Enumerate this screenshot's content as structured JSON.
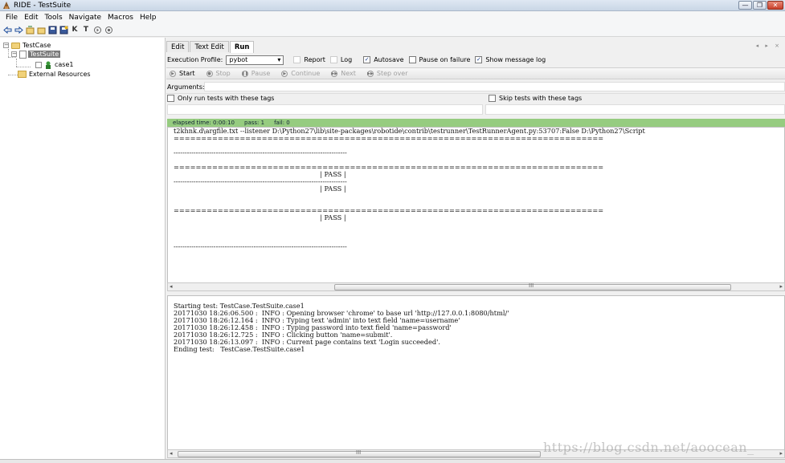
{
  "window": {
    "title": "RIDE - TestSuite",
    "controls": [
      "minimize",
      "restore",
      "close"
    ]
  },
  "menu": [
    "File",
    "Edit",
    "Tools",
    "Navigate",
    "Macros",
    "Help"
  ],
  "toolbar": {
    "icons": [
      "back-arrow-icon",
      "forward-arrow-icon",
      "open-suite-icon",
      "open-directory-icon",
      "save-icon",
      "save-all-icon",
      "search-keyword-icon",
      "search-test-icon",
      "step-icon",
      "record-icon"
    ],
    "k_glyph": "K",
    "t_glyph": "T"
  },
  "tree": {
    "root": "TestCase",
    "suite": "TestSuite",
    "case": "case1",
    "resources": "External Resources"
  },
  "tabs": [
    "Edit",
    "Text Edit",
    "Run"
  ],
  "tab_arrows": "◂ ▸ ×",
  "execution": {
    "profile_label": "Execution Profile:",
    "profile_value": "pybot",
    "report": "Report",
    "log": "Log",
    "autosave": "Autosave",
    "autosave_checked": true,
    "pause_on_failure": "Pause on failure",
    "pause_checked": false,
    "show_message_log": "Show message log",
    "show_checked": true
  },
  "run_controls": {
    "start": "Start",
    "stop": "Stop",
    "pause": "Pause",
    "continue": "Continue",
    "next": "Next",
    "step_over": "Step over"
  },
  "arguments_label": "Arguments:",
  "tags": {
    "only_run": "Only run tests with these tags",
    "skip": "Skip tests with these tags"
  },
  "status": {
    "elapsed": "elapsed time: 0:00:10",
    "pass": "pass: 1",
    "fail": "fail: 0"
  },
  "output_text": "t2khnk.d\\argfile.txt --listener D:\\Python27\\lib\\site-packages\\robotide\\contrib\\testrunner\\TestRunnerAgent.py:53707:False D:\\Python27\\Script\n==============================================================================\n\n------------------------------------------------------------------------------\n\n==============================================================================\n                                                                      | PASS |\n------------------------------------------------------------------------------\n                                                                      | PASS |\n\n\n==============================================================================\n                                                                      | PASS |\n\n\n\n------------------------------------------------------------------------------",
  "scroll_grip": "III",
  "log_text": "Starting test: TestCase.TestSuite.case1\n20171030 18:26:06.500 :  INFO : Opening browser 'chrome' to base url 'http://127.0.0.1:8080/html/'\n20171030 18:26:12.164 :  INFO : Typing text 'admin' into text field 'name=username'\n20171030 18:26:12.458 :  INFO : Typing password into text field 'name=password'\n20171030 18:26:12.725 :  INFO : Clicking button 'name=submit'.\n20171030 18:26:13.097 :  INFO : Current page contains text 'Login succeeded'.\nEnding test:   TestCase.TestSuite.case1",
  "watermark": "https://blog.csdn.net/aoocean_"
}
